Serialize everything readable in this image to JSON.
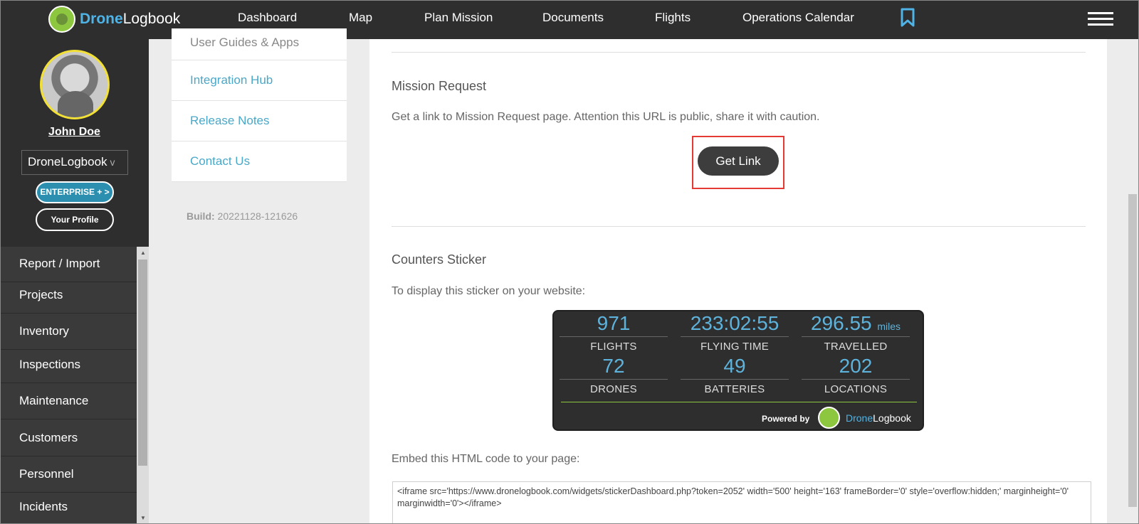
{
  "app": {
    "brand_prefix": "Drone",
    "brand_suffix": "Logbook"
  },
  "nav": {
    "items": [
      "Dashboard",
      "Map",
      "Plan Mission",
      "Documents",
      "Flights",
      "Operations Calendar"
    ]
  },
  "profile": {
    "name": "John Doe",
    "organization": "DroneLogbook",
    "org_chevron": "v",
    "plan_button": "ENTERPRISE + >",
    "profile_button": "Your Profile"
  },
  "menu": {
    "items": [
      "Report / Import",
      "Projects",
      "Inventory",
      "Inspections",
      "Maintenance",
      "Customers",
      "Personnel",
      "Incidents"
    ]
  },
  "sub_menu": {
    "items": [
      "User Guides & Apps",
      "Integration Hub",
      "Release Notes",
      "Contact Us"
    ],
    "build_label": "Build:",
    "build_value": "20221128-121626"
  },
  "mission_request": {
    "title": "Mission Request",
    "description": "Get a link to Mission Request page. Attention this URL is public, share it with caution.",
    "button": "Get Link"
  },
  "counters_sticker": {
    "title": "Counters Sticker",
    "description": "To display this sticker on your website:",
    "stats": [
      {
        "value": "971",
        "unit": "",
        "label": "FLIGHTS"
      },
      {
        "value": "233:02:55",
        "unit": "",
        "label": "FLYING TIME"
      },
      {
        "value": "296.55",
        "unit": "miles",
        "label": "TRAVELLED"
      },
      {
        "value": "72",
        "unit": "",
        "label": "DRONES"
      },
      {
        "value": "49",
        "unit": "",
        "label": "BATTERIES"
      },
      {
        "value": "202",
        "unit": "",
        "label": "LOCATIONS"
      }
    ],
    "powered_by": "Powered by",
    "brand_prefix": "Drone",
    "brand_suffix": "Logbook"
  },
  "embed": {
    "label": "Embed this HTML code to your page:",
    "code": "<iframe src='https://www.dronelogbook.com/widgets/stickerDashboard.php?token=2052' width='500' height='163' frameBorder='0' style='overflow:hidden;' marginheight='0' marginwidth='0'></iframe>"
  },
  "colors": {
    "accent": "#4fb3e6",
    "brand_green": "#8dc63f",
    "highlight": "#e53935",
    "nav_bg": "#2e2e2e"
  },
  "icons": [
    "logo-icon",
    "bookmark-icon",
    "hamburger-menu-icon",
    "chevron-down-icon",
    "scroll-up-icon",
    "scroll-down-icon"
  ]
}
